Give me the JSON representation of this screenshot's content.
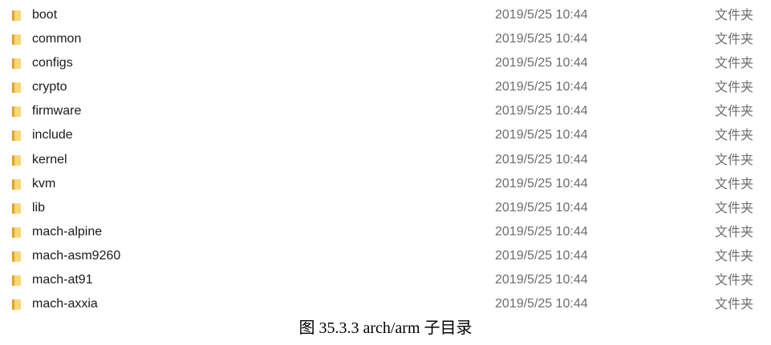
{
  "file_list": {
    "rows": [
      {
        "name": "boot",
        "date": "2019/5/25 10:44",
        "type": "文件夹",
        "icon": "folder-icon"
      },
      {
        "name": "common",
        "date": "2019/5/25 10:44",
        "type": "文件夹",
        "icon": "folder-icon"
      },
      {
        "name": "configs",
        "date": "2019/5/25 10:44",
        "type": "文件夹",
        "icon": "folder-icon"
      },
      {
        "name": "crypto",
        "date": "2019/5/25 10:44",
        "type": "文件夹",
        "icon": "folder-icon"
      },
      {
        "name": "firmware",
        "date": "2019/5/25 10:44",
        "type": "文件夹",
        "icon": "folder-icon"
      },
      {
        "name": "include",
        "date": "2019/5/25 10:44",
        "type": "文件夹",
        "icon": "folder-icon"
      },
      {
        "name": "kernel",
        "date": "2019/5/25 10:44",
        "type": "文件夹",
        "icon": "folder-icon"
      },
      {
        "name": "kvm",
        "date": "2019/5/25 10:44",
        "type": "文件夹",
        "icon": "folder-icon"
      },
      {
        "name": "lib",
        "date": "2019/5/25 10:44",
        "type": "文件夹",
        "icon": "folder-icon"
      },
      {
        "name": "mach-alpine",
        "date": "2019/5/25 10:44",
        "type": "文件夹",
        "icon": "folder-icon"
      },
      {
        "name": "mach-asm9260",
        "date": "2019/5/25 10:44",
        "type": "文件夹",
        "icon": "folder-icon"
      },
      {
        "name": "mach-at91",
        "date": "2019/5/25 10:44",
        "type": "文件夹",
        "icon": "folder-icon"
      },
      {
        "name": "mach-axxia",
        "date": "2019/5/25 10:44",
        "type": "文件夹",
        "icon": "folder-icon"
      }
    ]
  },
  "caption": "图 35.3.3 arch/arm 子目录",
  "colors": {
    "folder_light": "#F8D775",
    "folder_dark": "#E0A526",
    "name_text": "#1a1a1a",
    "meta_text": "#6d6d6d"
  }
}
